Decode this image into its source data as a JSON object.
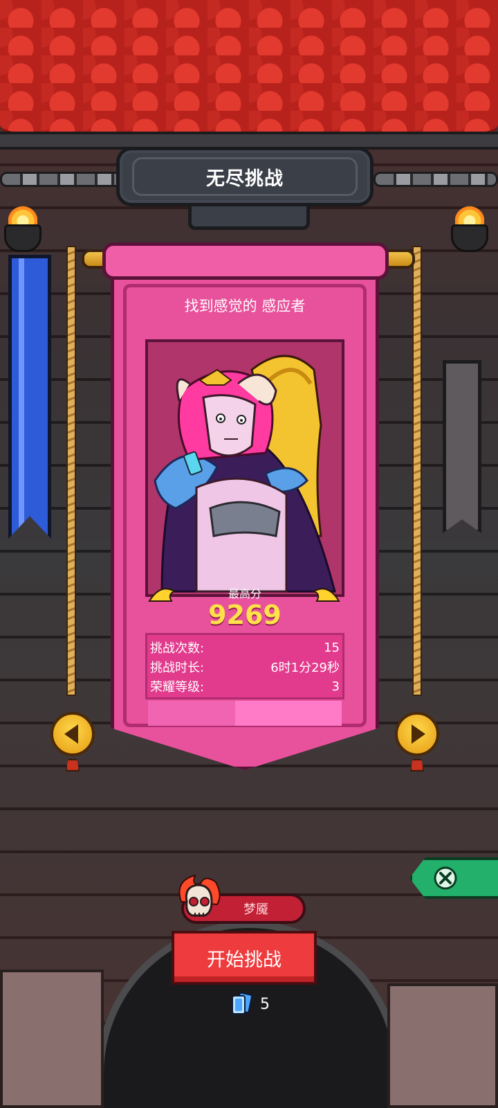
{
  "header": {
    "title": "无尽挑战"
  },
  "card": {
    "subtitle": "找到感觉的 感应者",
    "best_label": "最高分",
    "best_score": "9269",
    "stats": [
      {
        "label": "挑战次数:",
        "value": "15"
      },
      {
        "label": "挑战时长:",
        "value": "6时1分29秒"
      },
      {
        "label": "荣耀等级:",
        "value": "3"
      }
    ]
  },
  "difficulty": {
    "label": "梦魇"
  },
  "actions": {
    "start_label": "开始挑战",
    "ticket_count": "5"
  },
  "icons": {
    "prev": "chevron-left-icon",
    "next": "chevron-right-icon",
    "close": "close-icon",
    "skull": "flaming-skull-icon",
    "ticket": "card-ticket-icon"
  },
  "colors": {
    "card_pink": "#e8519b",
    "score_yellow": "#ffe14a",
    "start_red": "#ee3b3e",
    "difficulty_red": "#c22035",
    "close_green": "#23b06a"
  }
}
